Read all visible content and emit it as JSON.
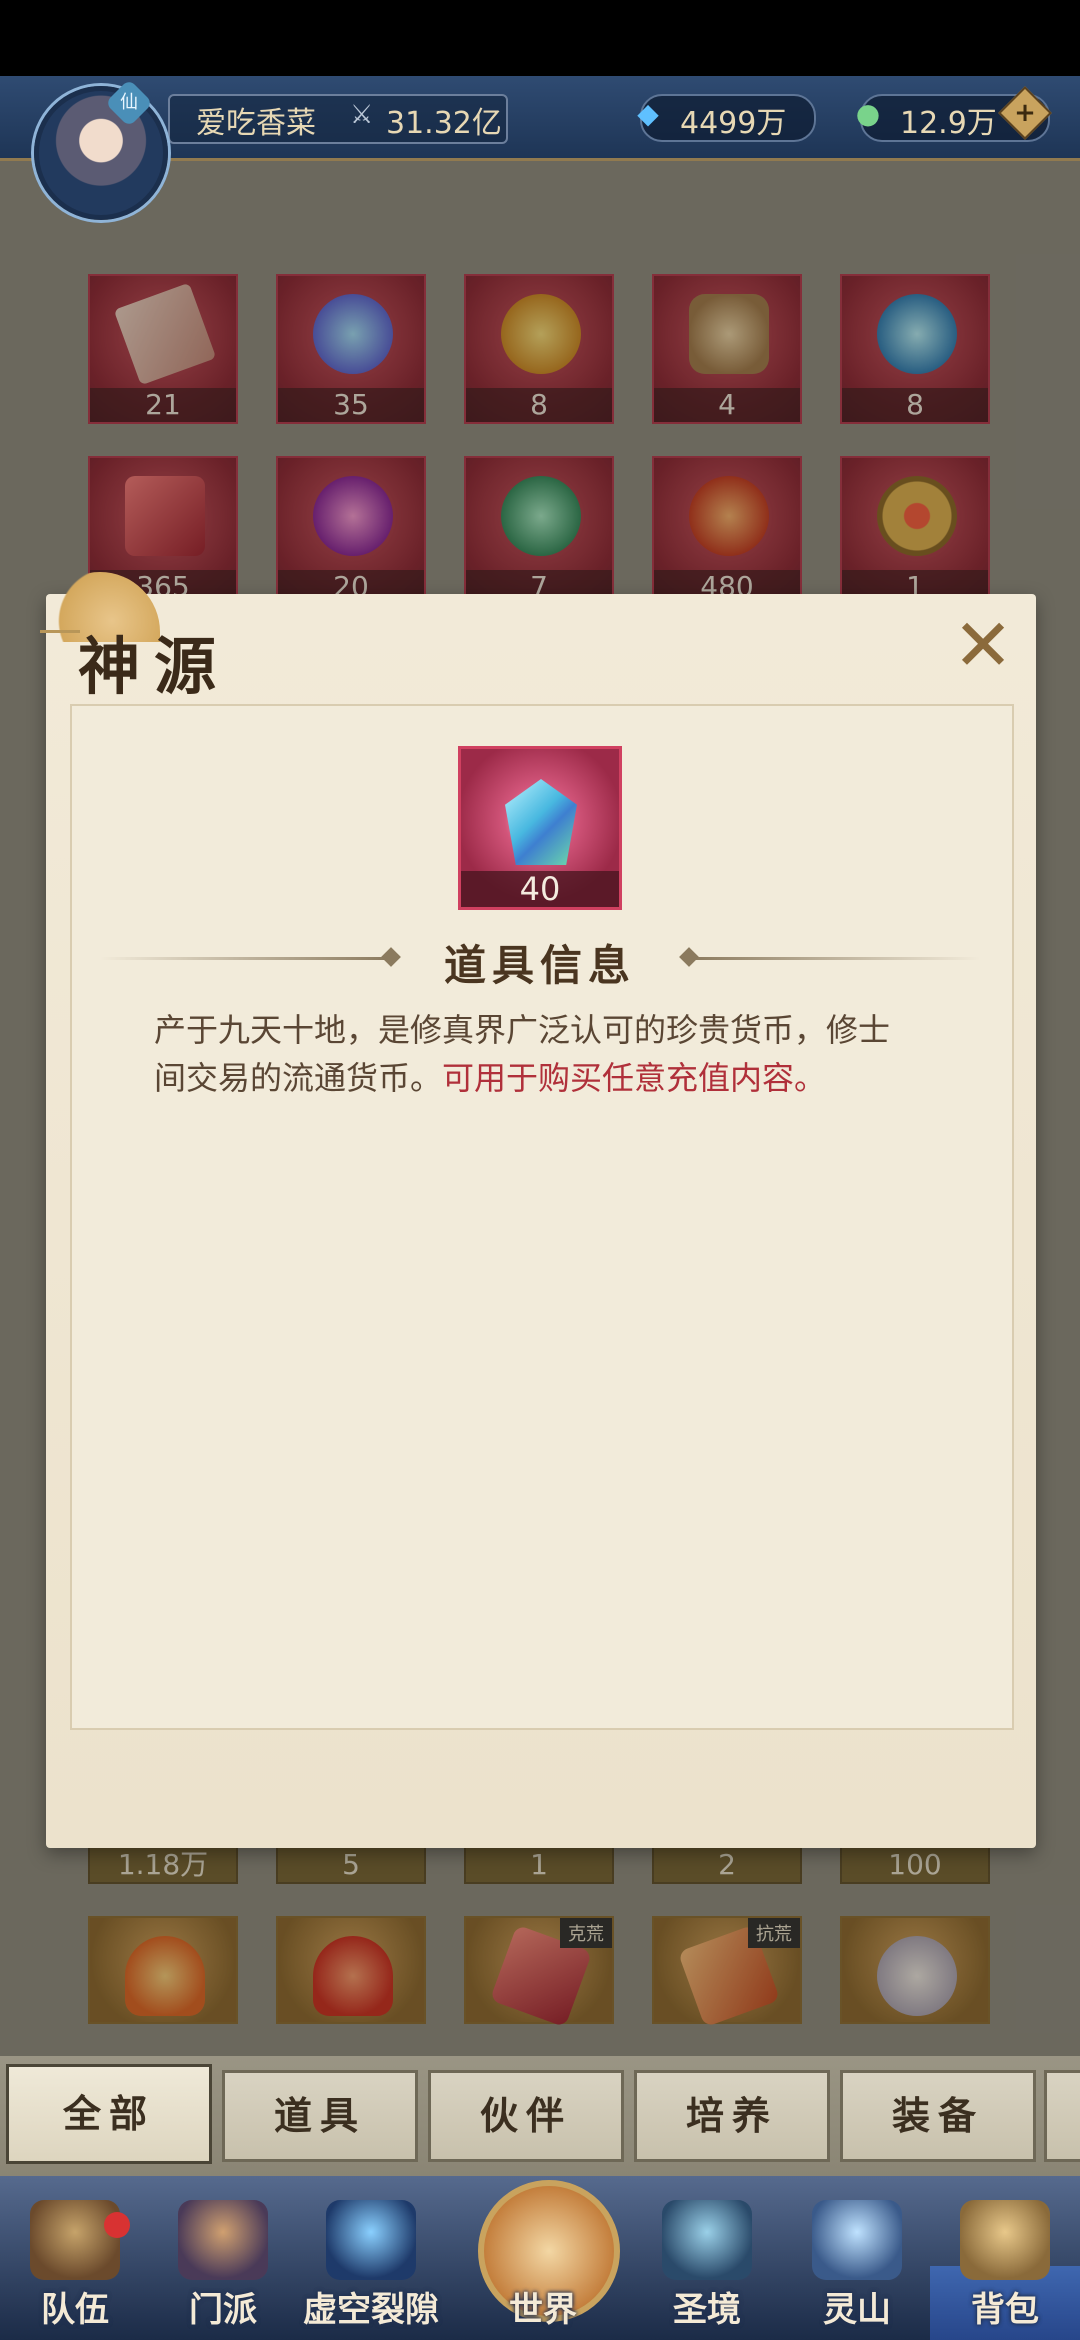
{
  "header": {
    "player_name": "爱吃香菜",
    "power": "31.32亿",
    "currency_1": "4499万",
    "currency_2": "12.9万",
    "avatar_badge": "仙"
  },
  "inventory": {
    "row1": [
      "21",
      "35",
      "8",
      "4",
      "8"
    ],
    "row2": [
      "365",
      "20",
      "7",
      "480",
      "1"
    ],
    "row_under_dialog": [
      "1.18万",
      "5",
      "1",
      "2",
      "100"
    ],
    "row_bottom_tags": [
      "克荒",
      "抗荒"
    ]
  },
  "dialog": {
    "title": "神源",
    "close": "✕",
    "item_count": "40",
    "section_title": "道具信息",
    "description_plain": "产于九天十地，是修真界广泛认可的珍贵货币，修士间交易的流通货币。",
    "description_highlight": "可用于购买任意充值内容。"
  },
  "tabs": [
    "全部",
    "道具",
    "伙伴",
    "培养",
    "装备"
  ],
  "nav": [
    "队伍",
    "门派",
    "虚空裂隙",
    "世界",
    "圣境",
    "灵山",
    "背包"
  ],
  "colors": {
    "header": "#2f4b72",
    "slot_red": "#b7344a",
    "highlight_text": "#b0303a"
  }
}
